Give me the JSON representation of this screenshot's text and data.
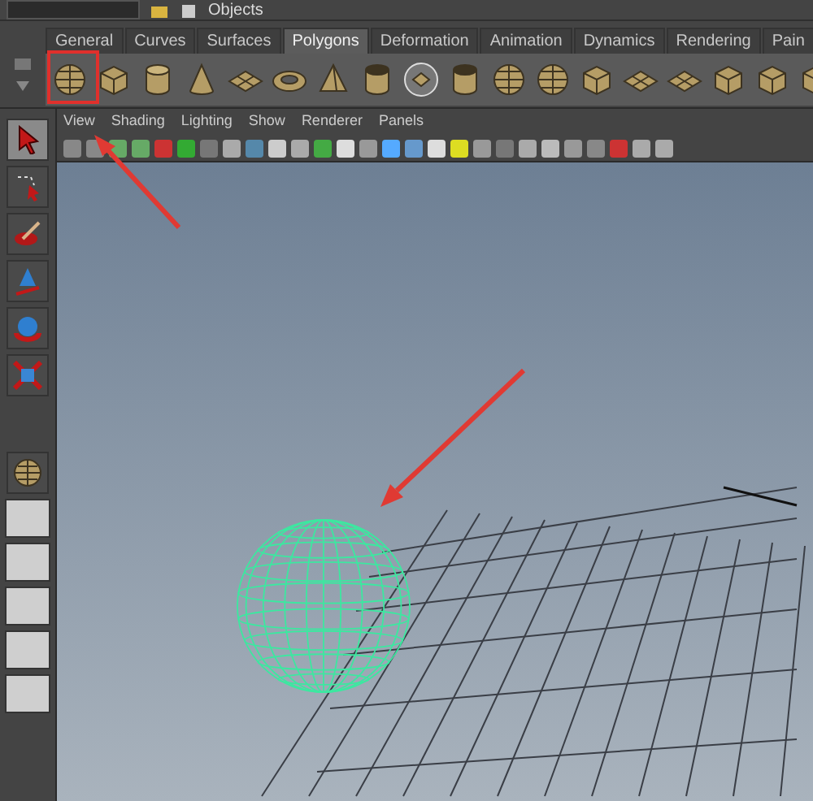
{
  "status_line": {
    "selection_mode": "Objects"
  },
  "shelf_tabs": [
    {
      "label": "General",
      "selected": false
    },
    {
      "label": "Curves",
      "selected": false
    },
    {
      "label": "Surfaces",
      "selected": false
    },
    {
      "label": "Polygons",
      "selected": true
    },
    {
      "label": "Deformation",
      "selected": false
    },
    {
      "label": "Animation",
      "selected": false
    },
    {
      "label": "Dynamics",
      "selected": false
    },
    {
      "label": "Rendering",
      "selected": false
    },
    {
      "label": "Pain",
      "selected": false
    }
  ],
  "viewport": {
    "menu": [
      "View",
      "Shading",
      "Lighting",
      "Show",
      "Renderer",
      "Panels"
    ]
  },
  "toolbox": [
    {
      "kind": "select",
      "selected": true
    },
    {
      "kind": "lasso",
      "selected": false
    },
    {
      "kind": "paint",
      "selected": false
    },
    {
      "kind": "move",
      "selected": false
    },
    {
      "kind": "rotate",
      "selected": false
    },
    {
      "kind": "scale",
      "selected": false
    },
    {
      "kind": "sphere",
      "selected": false
    }
  ]
}
